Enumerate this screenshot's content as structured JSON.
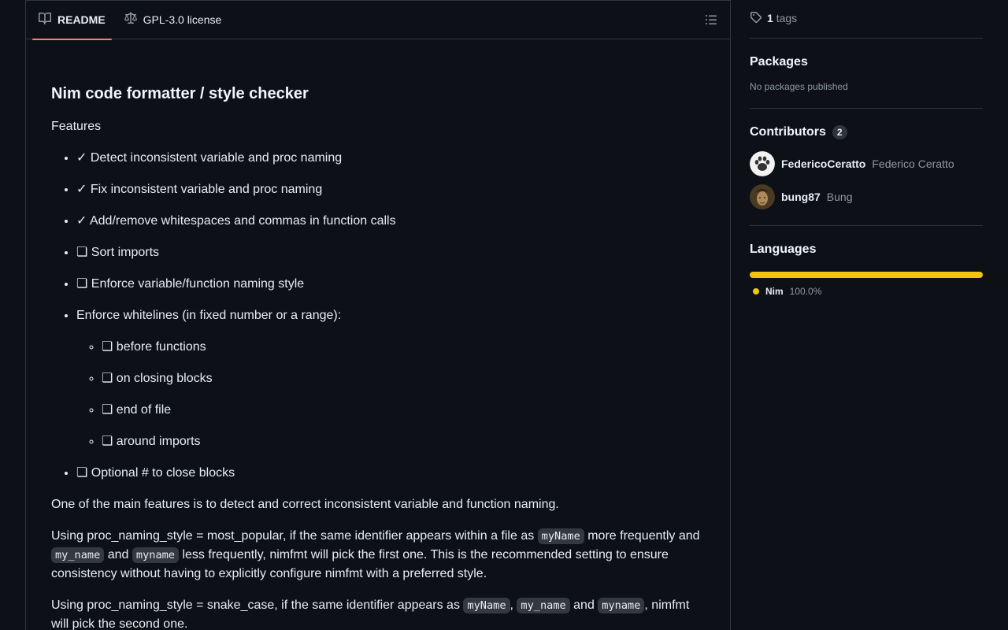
{
  "tabs": {
    "readme": "README",
    "license": "GPL-3.0 license"
  },
  "readme": {
    "title": "Nim code formatter / style checker",
    "features_label": "Features",
    "features": [
      "✓ Detect inconsistent variable and proc naming",
      "✓ Fix inconsistent variable and proc naming",
      "✓ Add/remove whitespaces and commas in function calls",
      "❏ Sort imports",
      "❏ Enforce variable/function naming style",
      "Enforce whitelines (in fixed number or a range):"
    ],
    "whitelines": [
      "❏ before functions",
      "❏ on closing blocks",
      "❏ end of file",
      "❏ around imports"
    ],
    "last_feature": "❏ Optional # to close blocks",
    "para1": "One of the main features is to detect and correct inconsistent variable and function naming.",
    "para2": {
      "t1": "Using proc_naming_style = most_popular, if the same identifier appears within a file as ",
      "c1": "myName",
      "t2": " more frequently and ",
      "c2": "my_name",
      "t3": " and ",
      "c3": "myname",
      "t4": " less frequently, nimfmt will pick the first one. This is the recommended setting to ensure consistency without having to explicitly configure nimfmt with a preferred style."
    },
    "para3": {
      "t1": "Using proc_naming_style = snake_case, if the same identifier appears as ",
      "c1": "myName",
      "t2": ", ",
      "c2": "my_name",
      "t3": " and ",
      "c3": "myname",
      "t4": ", nimfmt will pick the second one."
    }
  },
  "sidebar": {
    "tags_count": "1",
    "tags_label": "tags",
    "packages_title": "Packages",
    "packages_empty": "No packages published",
    "contributors_title": "Contributors",
    "contributors_count": "2",
    "contributors": [
      {
        "login": "FedericoCeratto",
        "name": "Federico Ceratto"
      },
      {
        "login": "bung87",
        "name": "Bung"
      }
    ],
    "languages_title": "Languages",
    "language": {
      "name": "Nim",
      "percent": "100.0%",
      "color": "#f1c40f"
    }
  }
}
